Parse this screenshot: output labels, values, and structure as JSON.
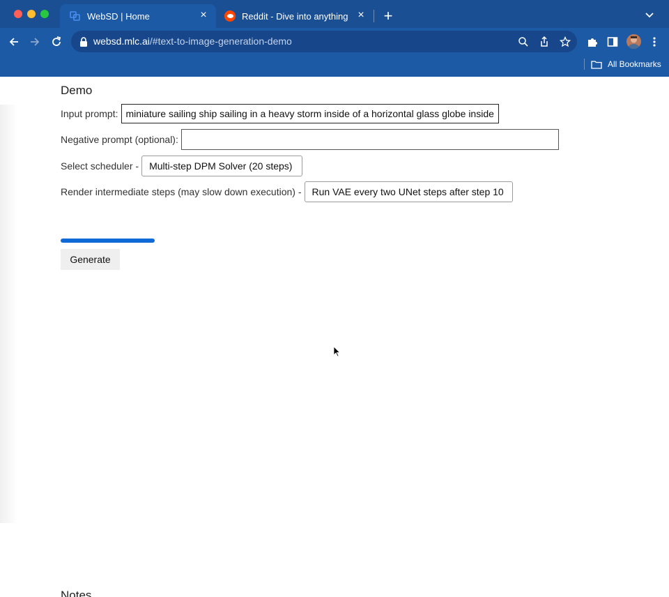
{
  "tabs": [
    {
      "title": "WebSD | Home",
      "active": true,
      "favicon": "websd-icon"
    },
    {
      "title": "Reddit - Dive into anything",
      "active": false,
      "favicon": "reddit-icon"
    }
  ],
  "address_bar": {
    "domain": "websd.mlc.ai",
    "path": "/#text-to-image-generation-demo"
  },
  "bookmarks": {
    "label": "All Bookmarks"
  },
  "page": {
    "heading": "Demo",
    "input_prompt": {
      "label": "Input prompt:",
      "value": "miniature sailing ship sailing in a heavy storm inside of a horizontal glass globe inside or"
    },
    "negative_prompt": {
      "label": "Negative prompt (optional):",
      "value": ""
    },
    "scheduler": {
      "label": "Select scheduler -",
      "selected": "Multi-step DPM Solver (20 steps)"
    },
    "render_steps": {
      "label": "Render intermediate steps (may slow down execution) -",
      "selected": "Run VAE every two UNet steps after step 10"
    },
    "progress": 1.0,
    "generate_label": "Generate",
    "notes_heading": "Notes"
  },
  "colors": {
    "chrome": "#1d5aa6",
    "tabstrip": "#1b4f94",
    "progress": "#0f6ad8"
  }
}
